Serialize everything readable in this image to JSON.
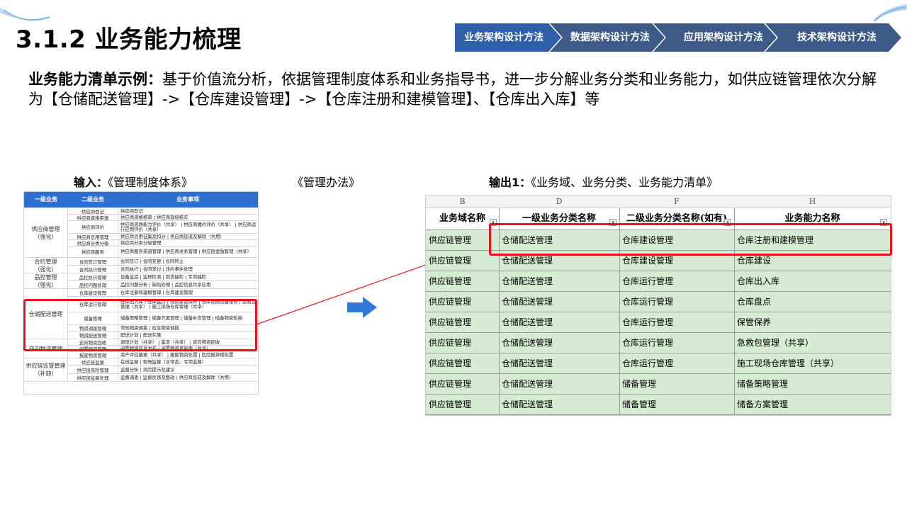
{
  "title": "3.1.2 业务能力梳理",
  "nav": {
    "steps": [
      "业务架构设计方法",
      "数据架构设计方法",
      "应用架构设计方法",
      "技术架构设计方法"
    ],
    "active_color": "#2f5fa8",
    "inactive_color": "#3e5a86"
  },
  "description": {
    "lead": "业务能力清单示例：",
    "text": "基于价值流分析，依据管理制度体系和业务指导书，进一步分解业务分类和业务能力，如供应链管理依次分解为【仓储配送管理】->【仓库建设管理】->【仓库注册和建模管理】、【仓库出入库】等"
  },
  "input_caption": {
    "lead": "输入：",
    "text": "《管理制度体系》",
    "text2": "《管理办法》"
  },
  "output_caption": {
    "lead": "输出1：",
    "text": "《业务域、业务分类、业务能力清单》"
  },
  "left_table": {
    "headers": [
      "一级业务",
      "二级业务",
      "业务事项"
    ],
    "groups": [
      {
        "label": "供应商管理\n（强化）",
        "rows": [
          [
            "供应商登记",
            "供应商登记"
          ],
          [
            "供应商资格审查",
            "供应商资格核审 | 供应商现场核实"
          ],
          [
            "供应商评价",
            "供应商资质能力评价（共享） | 供应商履约评价（共享） | 供应商运行应用评价（共享）"
          ],
          [
            "供应商信用管理",
            "供应商信用征集及扣分 | 供应商惩戒及解除（共用）"
          ],
          [
            "供应商分类分级",
            "供应商分类分级管理"
          ],
          [
            "供应商服务",
            "供应商服务渠道管理 | 供应商关系管理 | 供应链金融管理（共享）"
          ]
        ]
      },
      {
        "label": "合约管理\n（强化）",
        "rows": [
          [
            "合同签订管理",
            "合同签订 | 合同变更 | 合同终止"
          ],
          [
            "合同执行管理",
            "合同执行 | 合同支付 | 违约事件处理"
          ]
        ]
      },
      {
        "label": "品控管理\n（强化）",
        "rows": [
          [
            "品控执行管理",
            "设备监造 | 监样检测 | 到货抽检 | 专项抽检"
          ],
          [
            "品控问题处理",
            "品控问题分析 | 缺陷处理 | 品控信息共享应用"
          ]
        ]
      },
      {
        "label": "仓储配送管理",
        "rows": [
          [
            "仓库建设管理",
            "仓库注册和建模管理 | 仓库建设管理"
          ],
          [
            "仓库运行管理",
            "仓库出入库 | 仓库盘点 | 物资保管保养 | 仓库设施设备维修 | 急救包管理（共享） | 施工现场仓库管理（共享）"
          ],
          [
            "储备管理",
            "储备策略管理 | 储备方案管理 | 储备补货管理 | 储备物资轮换"
          ],
          [
            "物资调拨管理",
            "常规物资调拨 | 应急物资调拨"
          ],
          [
            "物资配送管理",
            "配送计划 | 配送实施"
          ]
        ]
      },
      {
        "label": "逆向物流管理",
        "rows": [
          [
            "逆向物资回收",
            "退役计划（共享） | 鉴定（共享） | 逆向物资回收"
          ],
          [
            "闲置物资管理",
            "闲置物资信息发布 | 闲置物资再利用（共享）"
          ],
          [
            "报废物资管理",
            "资产评估备案（共享） | 报废物资处置 | 危险废弃物处置"
          ]
        ]
      },
      {
        "label": "供应链监督管理\n（补缺）",
        "rows": [
          [
            "供应链监督",
            "在线监督 | 现场监督（含常态、专项监督）"
          ],
          [
            "供应链风险管理",
            "监督分析 | 风险提示及建议"
          ],
          [
            "供应链监督处理",
            "监督调查 | 监督反馈及整改 | 供应商惩戒及解除（共用）"
          ]
        ]
      }
    ]
  },
  "right_table": {
    "col_letters": [
      "B",
      "D",
      "F",
      "H"
    ],
    "headers": [
      "业务域名称",
      "一级业务分类名称",
      "二级业务分类名称(如有)",
      "业务能力名称"
    ],
    "rows": [
      [
        "供应链管理",
        "仓储配送管理",
        "仓库建设管理",
        "仓库注册和建模管理"
      ],
      [
        "供应链管理",
        "仓储配送管理",
        "仓库建设管理",
        "仓库建设"
      ],
      [
        "供应链管理",
        "仓储配送管理",
        "仓库运行管理",
        "仓库出入库"
      ],
      [
        "供应链管理",
        "仓储配送管理",
        "仓库运行管理",
        "仓库盘点"
      ],
      [
        "供应链管理",
        "仓储配送管理",
        "仓库运行管理",
        "保管保养"
      ],
      [
        "供应链管理",
        "仓储配送管理",
        "仓库运行管理",
        "急救包管理（共享）"
      ],
      [
        "供应链管理",
        "仓储配送管理",
        "仓库运行管理",
        "施工现场仓库管理（共享）"
      ],
      [
        "供应链管理",
        "仓储配送管理",
        "储备管理",
        "储备策略管理"
      ],
      [
        "供应链管理",
        "仓储配送管理",
        "储备管理",
        "储备方案管理"
      ]
    ]
  },
  "colors": {
    "header_blue": "#2f6fd1",
    "highlight_red": "#e8141b",
    "row_green": "#d6ecd2",
    "arrow_blue": "#2f78d6"
  }
}
